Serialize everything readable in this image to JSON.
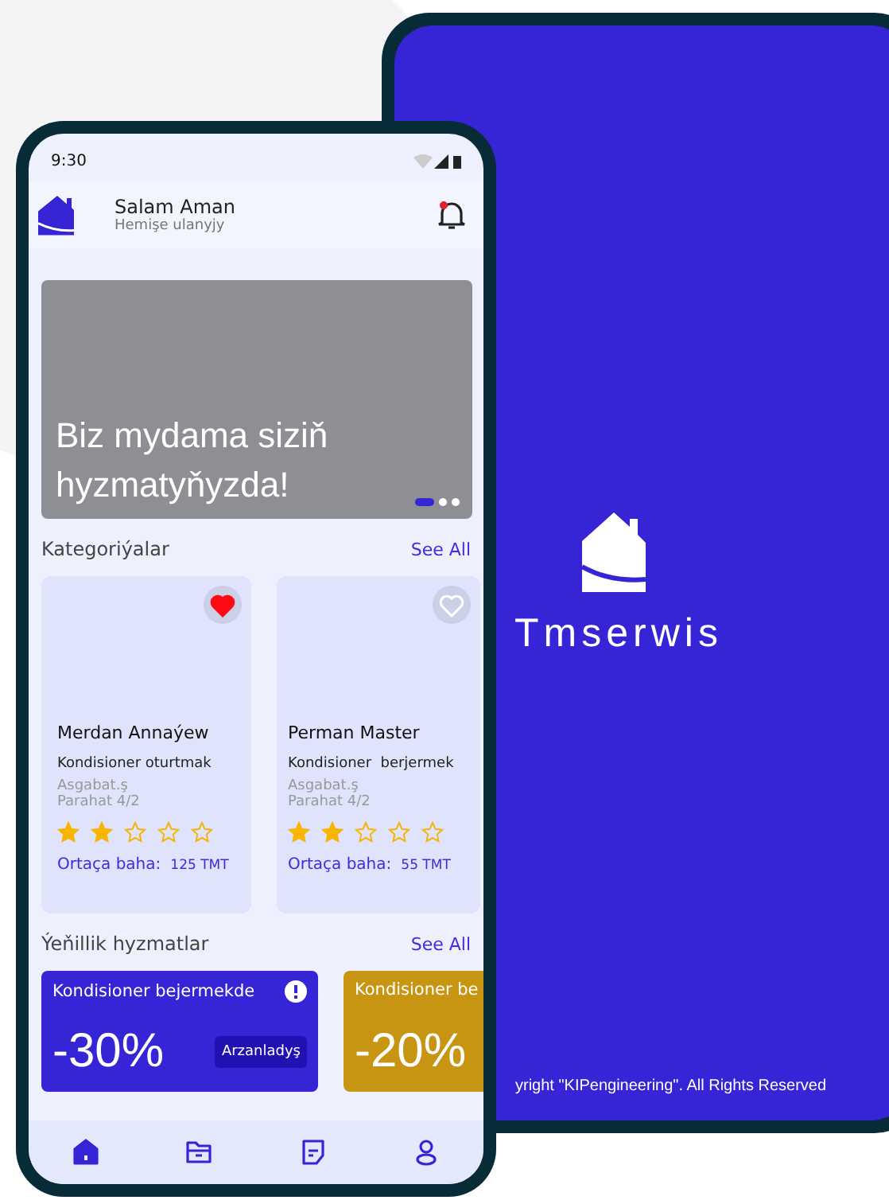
{
  "back_phone": {
    "app_name": "Tmserwis",
    "copyright": "yright \"KIPengineering\". All Rights Reserved"
  },
  "front_phone": {
    "status_bar": {
      "time": "9:30"
    },
    "header": {
      "name": "Salam Aman",
      "subtitle": "Hemişe ulanyjy",
      "notification": true
    },
    "banner": {
      "text": "Biz mydama siziň hyzmatyňyzda!",
      "pages": [
        {
          "selected": true
        },
        {
          "selected": false
        },
        {
          "selected": false
        }
      ]
    },
    "categories": {
      "title": "Kategoriýalar",
      "see_all": "See All",
      "cards": [
        {
          "name": "Merdan Annaýew",
          "service": "Kondisioner oturtmak",
          "address_1": "Asgabat.ş",
          "address_2": "Parahat 4/2",
          "stars": 2,
          "price_label": "Ortaça baha:",
          "price": "125 TMT",
          "favorite": true
        },
        {
          "name": "Perman Master",
          "service": "Kondisioner  berjermek",
          "address_1": "Asgabat.ş",
          "address_2": "Parahat 4/2",
          "stars": 2,
          "price_label": "Ortaça baha:",
          "price": "55 TMT",
          "favorite": false
        }
      ]
    },
    "offers": {
      "title": "Ýeňillik hyzmatlar",
      "see_all": "See All",
      "cards": [
        {
          "title": "Kondisioner bejermekde",
          "discount": "-30%",
          "badge": "Arzanladyş",
          "color": "#3525d6"
        },
        {
          "title": "Kondisioner be",
          "discount": "-20%",
          "color": "#c89512"
        }
      ]
    },
    "nav": [
      {
        "kind": "home",
        "selected": true
      },
      {
        "kind": "folder",
        "selected": false
      },
      {
        "kind": "document",
        "selected": false
      },
      {
        "kind": "profile",
        "selected": false
      }
    ]
  }
}
